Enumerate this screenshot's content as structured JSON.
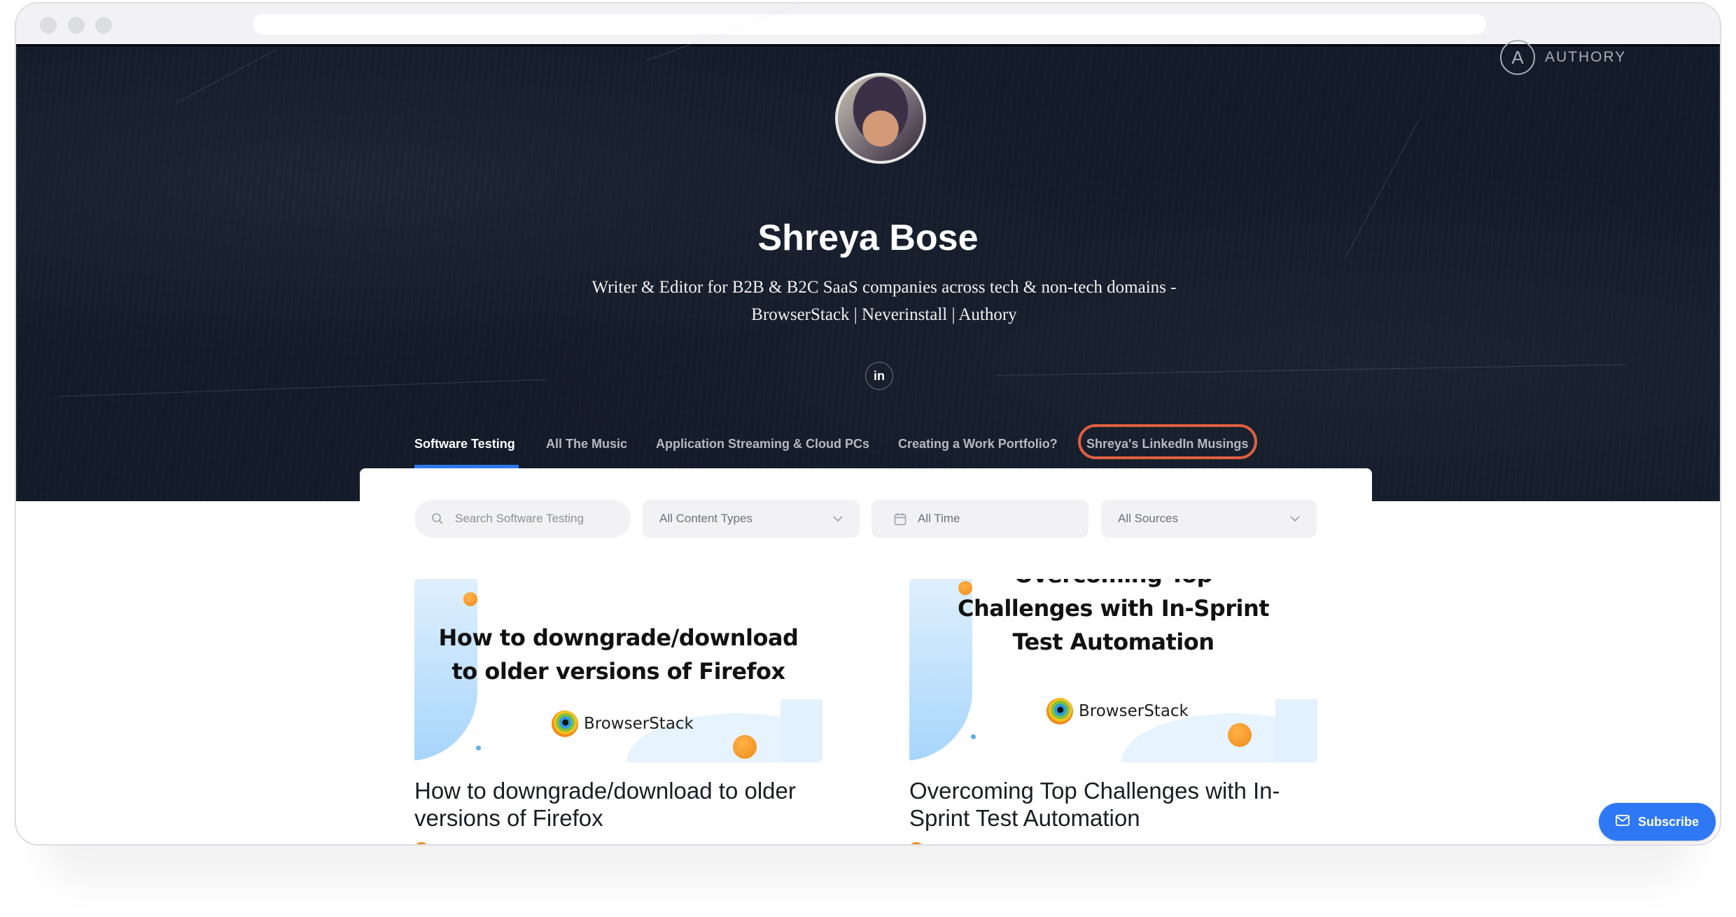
{
  "window": {
    "traffic_lights": [
      "close",
      "minimize",
      "maximize"
    ],
    "url": ""
  },
  "brand": {
    "logo_letter": "A",
    "name": "AUTHORY"
  },
  "profile": {
    "name": "Shreya Bose",
    "bio_line1": "Writer & Editor for B2B & B2C SaaS companies across tech & non-tech domains -",
    "bio_line2": "BrowserStack | Neverinstall | Authory",
    "social": [
      {
        "icon": "linkedin-icon",
        "label": "in"
      }
    ]
  },
  "tabs": [
    {
      "label": "Software Testing",
      "active": true
    },
    {
      "label": "All The Music",
      "active": false
    },
    {
      "label": "Application Streaming & Cloud PCs",
      "active": false
    },
    {
      "label": "Creating a Work Portfolio?",
      "active": false
    },
    {
      "label": "Shreya's LinkedIn Musings",
      "active": false,
      "highlighted": true
    }
  ],
  "filters": {
    "search_placeholder": "Search Software Testing",
    "content_types": "All Content Types",
    "time": "All Time",
    "sources": "All Sources"
  },
  "articles": [
    {
      "thumb_title_line1": "How to downgrade/download",
      "thumb_title_line2": "to older versions of Firefox",
      "thumb_brand": "BrowserStack",
      "title": "How to downgrade/download to older versions of Firefox"
    },
    {
      "thumb_title_line0": "Overcoming Top",
      "thumb_title_line1": "Challenges with In-Sprint",
      "thumb_title_line2": "Test Automation",
      "thumb_brand": "BrowserStack",
      "title": "Overcoming Top Challenges with In-Sprint Test Automation"
    }
  ],
  "subscribe": {
    "label": "Subscribe",
    "icon": "mail-icon"
  },
  "colors": {
    "hero_bg": "#131a28",
    "accent": "#2f78f0",
    "highlight": "#e05f3f",
    "subscribe_bg": "#2f78f5"
  }
}
